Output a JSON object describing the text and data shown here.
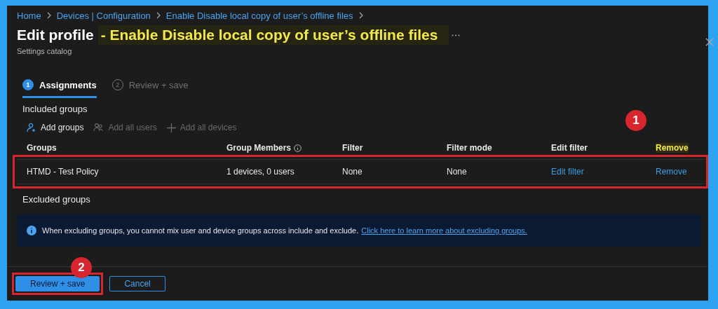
{
  "breadcrumb": [
    "Home",
    "Devices | Configuration",
    "Enable Disable local copy of user’s offline files"
  ],
  "header": {
    "title": "Edit profile",
    "title_highlight": "- Enable Disable local copy of user’s offline files",
    "subtitle": "Settings catalog"
  },
  "steps": [
    {
      "number": "1",
      "label": "Assignments",
      "selected": true
    },
    {
      "number": "2",
      "label": "Review + save",
      "selected": false
    }
  ],
  "included": {
    "heading": "Included groups",
    "actions": [
      {
        "kind": "person",
        "label": "Add groups",
        "disabled": false
      },
      {
        "kind": "people",
        "label": "Add all users",
        "disabled": true
      },
      {
        "kind": "plus",
        "label": "Add all devices",
        "disabled": true
      }
    ],
    "columns": [
      {
        "label": "Groups",
        "info": false,
        "highlighted": false
      },
      {
        "label": "Group Members",
        "info": true,
        "highlighted": false
      },
      {
        "label": "Filter",
        "info": false,
        "highlighted": false
      },
      {
        "label": "Filter mode",
        "info": false,
        "highlighted": false
      },
      {
        "label": "Edit filter",
        "info": false,
        "highlighted": false
      },
      {
        "label": "Remove",
        "info": false,
        "highlighted": true
      }
    ],
    "rows": [
      {
        "group": "HTMD - Test Policy",
        "members": "1 devices, 0 users",
        "filter": "None",
        "filter_mode": "None",
        "edit_filter": "Edit filter",
        "remove": "Remove",
        "highlighted": true
      }
    ]
  },
  "excluded": {
    "heading": "Excluded groups",
    "notice": "When excluding groups, you cannot mix user and device groups across include and exclude.",
    "notice_link": "Click here to learn more about excluding groups."
  },
  "buttons": [
    {
      "label": "Review + save",
      "kind": "primary",
      "highlighted": true
    },
    {
      "label": "Cancel",
      "kind": "secondary"
    }
  ],
  "annotations": [
    {
      "number": "1"
    },
    {
      "number": "2"
    }
  ]
}
